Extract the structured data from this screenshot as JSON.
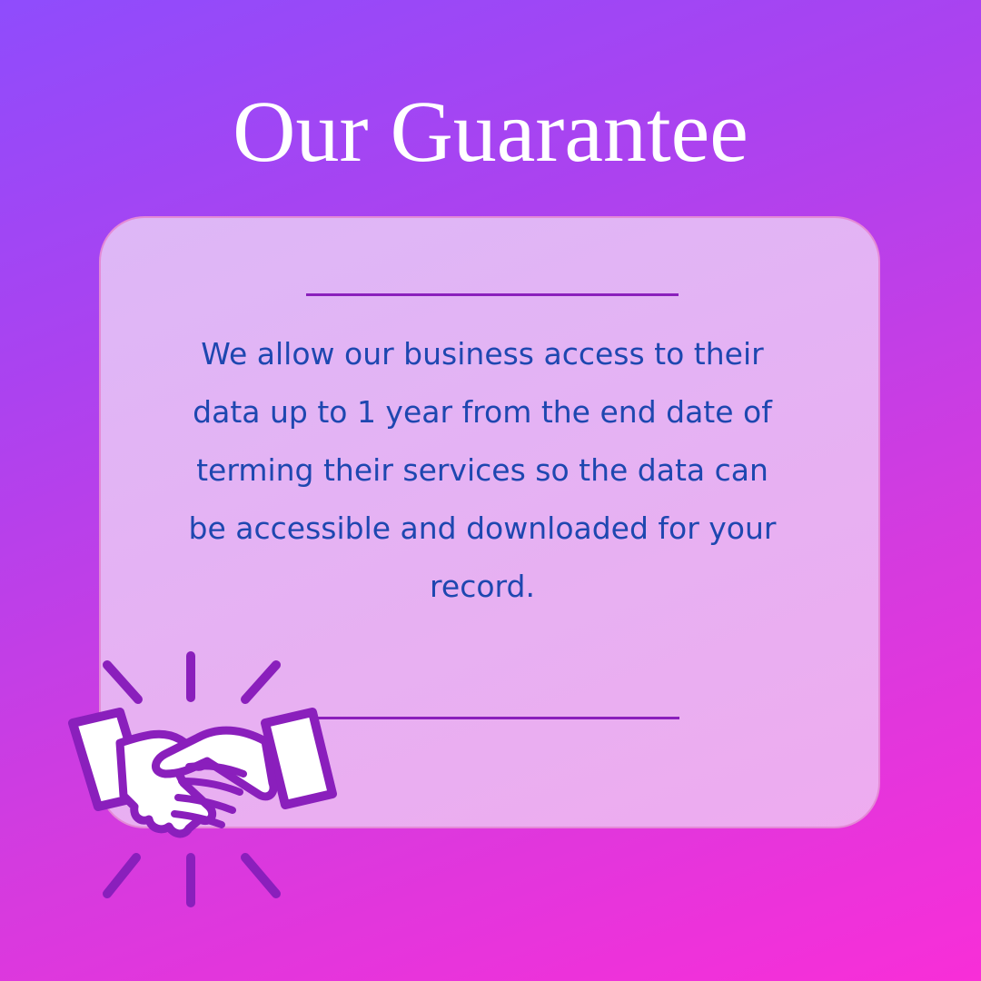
{
  "heading": {
    "title": "Our Guarantee"
  },
  "card": {
    "body": "We allow our business access to their data up to 1 year from the end date of terming their services so the data can be accessible and downloaded for your record."
  },
  "icons": {
    "handshake": "handshake-icon"
  },
  "colors": {
    "background_top": "#8f4cfc",
    "background_bottom": "#f82ed8",
    "card_fill": "#e8b8f2",
    "divider": "#8a1fbc",
    "body_text": "#1e47b0",
    "icon_stroke": "#8a1fbc"
  }
}
